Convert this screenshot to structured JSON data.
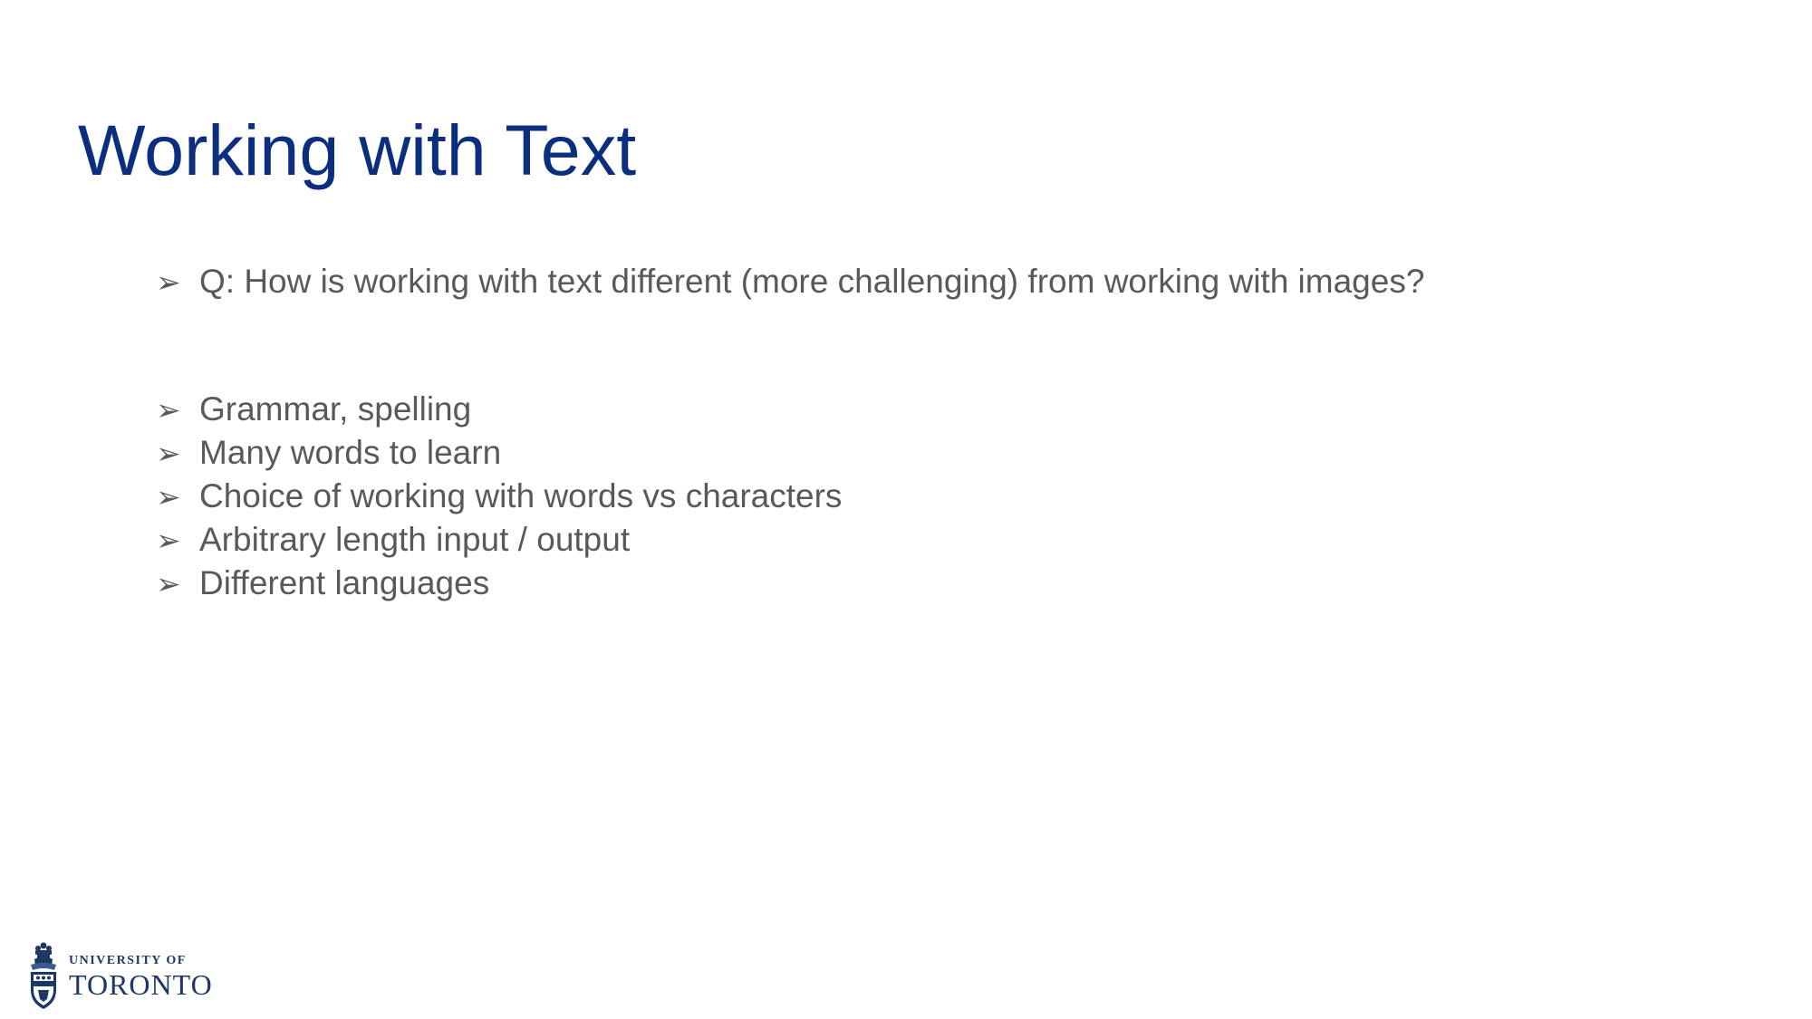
{
  "slide": {
    "title": "Working with Text",
    "bullet_glyph": "➢",
    "question": "Q: How is working with text different (more challenging) from working with images?",
    "answers": [
      "Grammar, spelling",
      "Many words to learn",
      "Choice of working with words vs characters",
      "Arbitrary length input / output",
      "Different languages"
    ]
  },
  "logo": {
    "line1": "UNIVERSITY OF",
    "line2": "TORONTO"
  },
  "colors": {
    "title": "#0b2f7e",
    "body_text": "#595959",
    "logo": "#1e3765",
    "background": "#ffffff"
  }
}
